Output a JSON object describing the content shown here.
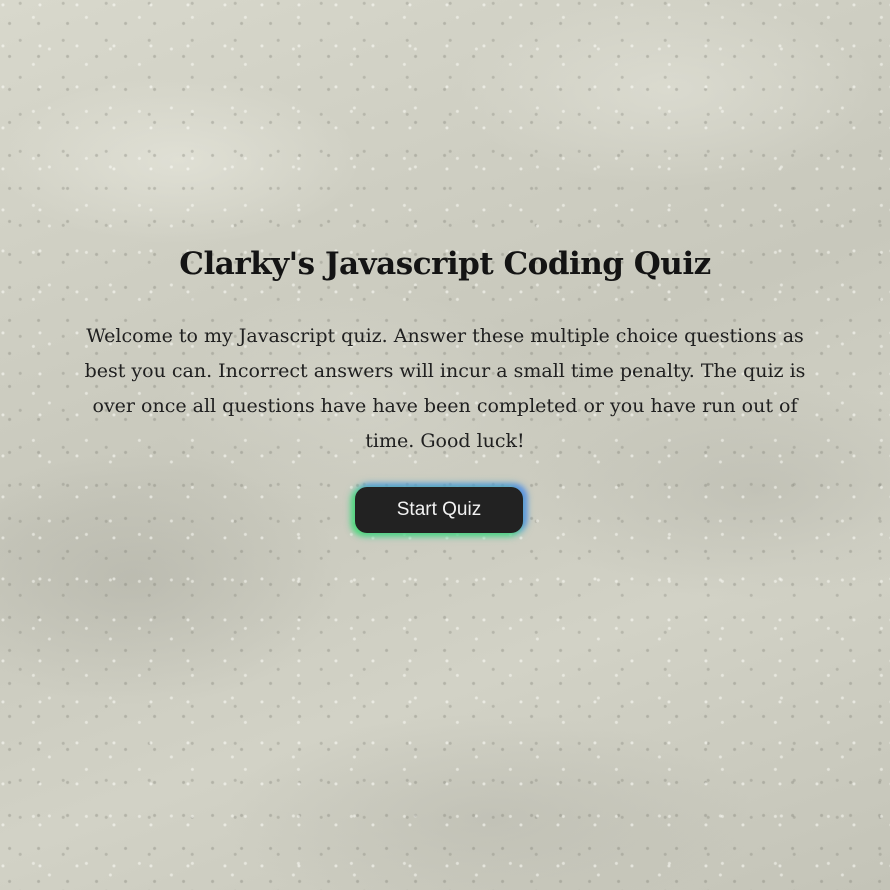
{
  "page": {
    "title": "Clarky's Javascript Coding Quiz",
    "description": "Welcome to my Javascript quiz. Answer these multiple choice questions as best you can. Incorrect answers will incur a small time penalty. The quiz is over once all questions have have been completed or you have run out of time. Good luck!",
    "start_button_label": "Start Quiz"
  },
  "colors": {
    "button_background": "#222222",
    "button_text": "#f2f2f2",
    "button_glow_start": "#46dc6e",
    "button_glow_end": "#5082f0",
    "text": "#1a1a1a"
  }
}
